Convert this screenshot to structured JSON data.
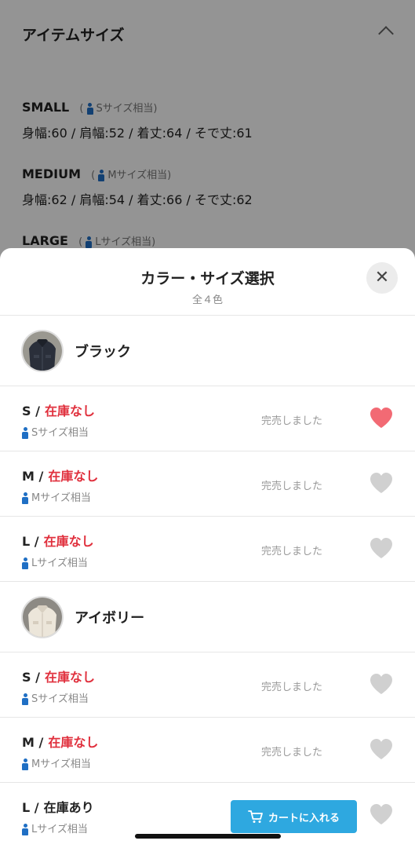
{
  "background": {
    "section_title": "アイテムサイズ",
    "sizes": [
      {
        "name": "SMALL",
        "equiv": "Sサイズ相当",
        "measurements": "身幅:60 / 肩幅:52 / 着丈:64 / そで丈:61"
      },
      {
        "name": "MEDIUM",
        "equiv": "Mサイズ相当",
        "measurements": "身幅:62 / 肩幅:54 / 着丈:66 / そで丈:62"
      },
      {
        "name": "LARGE",
        "equiv": "Lサイズ相当"
      }
    ]
  },
  "sheet": {
    "title": "カラー・サイズ選択",
    "subtitle": "全４色",
    "close_icon": "close-icon",
    "colors": [
      {
        "name": "ブラック",
        "sizes": [
          {
            "label": "S /",
            "stock": "在庫なし",
            "equiv": "Sサイズ相当",
            "status": "完売しました",
            "favorited": true
          },
          {
            "label": "M /",
            "stock": "在庫なし",
            "equiv": "Mサイズ相当",
            "status": "完売しました",
            "favorited": false
          },
          {
            "label": "L /",
            "stock": "在庫なし",
            "equiv": "Lサイズ相当",
            "status": "完売しました",
            "favorited": false
          }
        ]
      },
      {
        "name": "アイボリー",
        "sizes": [
          {
            "label": "S /",
            "stock": "在庫なし",
            "equiv": "Sサイズ相当",
            "status": "完売しました",
            "favorited": false
          },
          {
            "label": "M /",
            "stock": "在庫なし",
            "equiv": "Mサイズ相当",
            "status": "完売しました",
            "favorited": false
          },
          {
            "label": "L /",
            "stock": "在庫あり",
            "equiv": "Lサイズ相当",
            "cart_label": "カートに入れる",
            "favorited": false
          }
        ]
      }
    ]
  },
  "colors": {
    "accent": "#2ea8e0",
    "out_of_stock": "#e0303d",
    "heart_active": "#f26a74",
    "heart_inactive": "#d0d0d0",
    "person_icon": "#1f6fc4"
  }
}
